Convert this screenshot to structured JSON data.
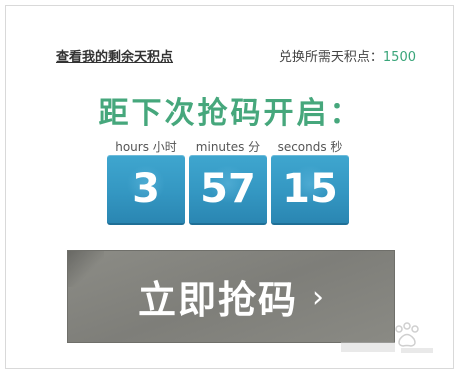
{
  "header": {
    "my_points_link": "查看我的剩余天积点",
    "required_points_label": "兑换所需天积点：",
    "required_points_value": "1500"
  },
  "countdown": {
    "title": "距下次抢码开启：",
    "units": {
      "hours": "hours 小时",
      "minutes": "minutes 分",
      "seconds": "seconds 秒"
    },
    "values": {
      "hours": "3",
      "minutes": "57",
      "seconds": "15"
    }
  },
  "action": {
    "grab_label": "立即抢码",
    "chevron": "›"
  },
  "colors": {
    "accent_green": "#46a77c",
    "timer_blue": "#3497c2",
    "button_gray": "#84847f"
  },
  "icons": {
    "chevron": "chevron-right-icon",
    "watermark": "baidu-watermark-logo"
  }
}
